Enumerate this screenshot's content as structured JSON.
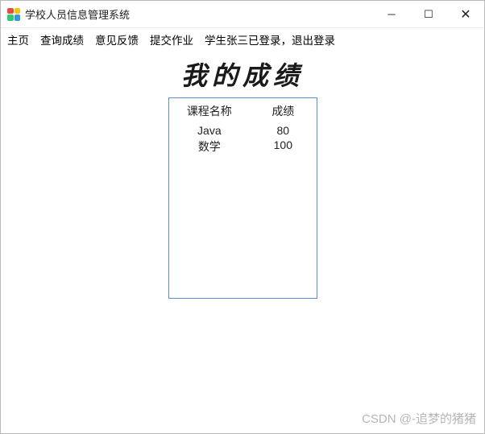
{
  "window": {
    "title": "学校人员信息管理系统"
  },
  "menubar": {
    "items": [
      {
        "label": "主页"
      },
      {
        "label": "查询成绩"
      },
      {
        "label": "意见反馈"
      },
      {
        "label": "提交作业"
      },
      {
        "label": "学生张三已登录，退出登录"
      }
    ]
  },
  "content": {
    "heading": "我的成绩",
    "table_header": {
      "course": "课程名称",
      "score": "成绩"
    },
    "rows": [
      {
        "course": "Java",
        "score": "80"
      },
      {
        "course": "数学",
        "score": "100"
      }
    ]
  },
  "watermark": "CSDN @-追梦的猪猪"
}
